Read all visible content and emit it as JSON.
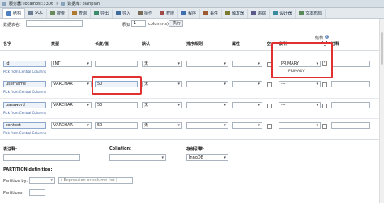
{
  "breadcrumb": {
    "server": "服务器: localhost:3306",
    "database": "数据库: pianpian"
  },
  "tabs": [
    {
      "label": "结构",
      "color": "#4f7fbf"
    },
    {
      "label": "SQL",
      "color": "#6a7f94"
    },
    {
      "label": "搜索",
      "color": "#6a8a5a"
    },
    {
      "label": "查询",
      "color": "#b07a30"
    },
    {
      "label": "导出",
      "color": "#3c8c6c"
    },
    {
      "label": "导入",
      "color": "#3c6c9c"
    },
    {
      "label": "操作",
      "color": "#7a6a5a"
    },
    {
      "label": "权限",
      "color": "#a04848"
    },
    {
      "label": "程序",
      "color": "#3f6fb0"
    },
    {
      "label": "事件",
      "color": "#a05a30"
    },
    {
      "label": "触发器",
      "color": "#7a7a30"
    },
    {
      "label": "追踪",
      "color": "#5a5a8a"
    },
    {
      "label": "设计器",
      "color": "#3a8aa0"
    },
    {
      "label": "文本布局",
      "color": "#5a8a5a"
    }
  ],
  "top": {
    "table_label": "数据表名:",
    "add_label": "添加",
    "add_value": "1",
    "columns_label": "column(s)",
    "go_label": "执行",
    "structure_label": "结构",
    "structure_icon": "help-icon"
  },
  "headers": {
    "name": "名字",
    "type": "类型",
    "length": "长度/值",
    "default": "默认",
    "collation": "排序规则",
    "attributes": "属性",
    "null": "空",
    "index": "索引",
    "ai": "A_I",
    "comment": "注释"
  },
  "rows": [
    {
      "name": "id",
      "type": "INT",
      "length": "",
      "default": "无",
      "index": "PRIMARY",
      "ai_checked": true
    },
    {
      "name": "username",
      "type": "VARCHAR",
      "length": "50",
      "default": "无",
      "index": "---",
      "ai_checked": false
    },
    {
      "name": "password",
      "type": "VARCHAR",
      "length": "50",
      "default": "无",
      "index": "---",
      "ai_checked": false
    },
    {
      "name": "contect",
      "type": "VARCHAR",
      "length": "50",
      "default": "无",
      "index": "---",
      "ai_checked": false
    }
  ],
  "pick_label": "Pick from Central Columns",
  "index_menu": [
    "PRIMARY",
    "PRIMARY"
  ],
  "footer": {
    "comment_label": "表注释:",
    "collation_label": "Collation:",
    "engine_label": "存储引擎:",
    "engine_value": "InnoDB",
    "partition_title": "PARTITION definition:",
    "partition_by_label": "Partition by:",
    "partition_expr_placeholder": "( Expression or column list )",
    "partitions_label": "Partitions:"
  }
}
